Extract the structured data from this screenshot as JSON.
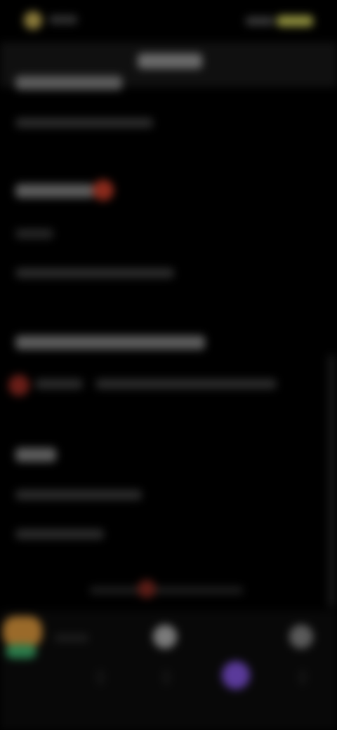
{
  "colors": {
    "background": "#000000",
    "header_bg": "#101010",
    "accent_red": "#8a2a1c",
    "accent_purple": "#5a3a9a",
    "accent_yellow": "#8c8c3c",
    "accent_orange": "#9a6a2a",
    "accent_green": "#2a7a4a"
  },
  "icons": {
    "status_left": "app-status-icon",
    "status_right": "battery-icon",
    "section_badge": "notification-dot-icon",
    "row_badge": "record-dot-icon",
    "indicator_dot": "indicator-dot-icon",
    "nav_first": "home-icon",
    "nav_center": "circle-icon",
    "nav_right": "profile-icon",
    "nav_purple": "assistant-icon"
  }
}
